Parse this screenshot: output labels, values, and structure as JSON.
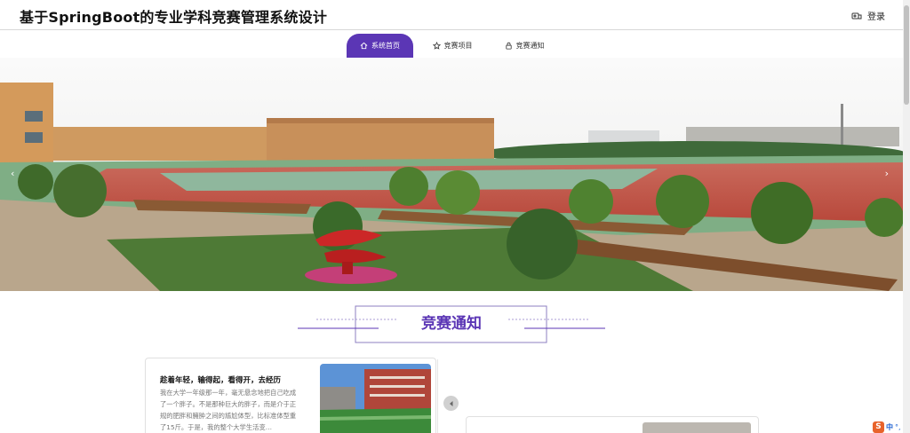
{
  "header": {
    "title": "基于SpringBoot的专业学科竞赛管理系统设计",
    "login_label": "登录"
  },
  "nav": {
    "items": [
      {
        "label": "系统首页",
        "icon": "home-icon",
        "active": true
      },
      {
        "label": "竞赛项目",
        "icon": "star-icon",
        "active": false
      },
      {
        "label": "竞赛通知",
        "icon": "lock-icon",
        "active": false
      }
    ]
  },
  "banner": {
    "arrow_left": "‹",
    "arrow_right": "›"
  },
  "section": {
    "title": "竞赛通知"
  },
  "notices": [
    {
      "title": "趁着年轻，输得起，看得开，去经历",
      "body": "我在大学一年级那一年，毫无悬念地把自己吃成了一个胖子。不是那种巨大的胖子，而是介于正规的肥胖和臃肿之间的尴尬体型，比标准体型重了15斤。于是，我的整个大学生活变…"
    }
  ],
  "ime": {
    "logo": "S",
    "mode": "中",
    "extra": "°,"
  },
  "colors": {
    "accent": "#5b36b5",
    "track": "#c5584a",
    "sky": "#f2f2f0"
  }
}
